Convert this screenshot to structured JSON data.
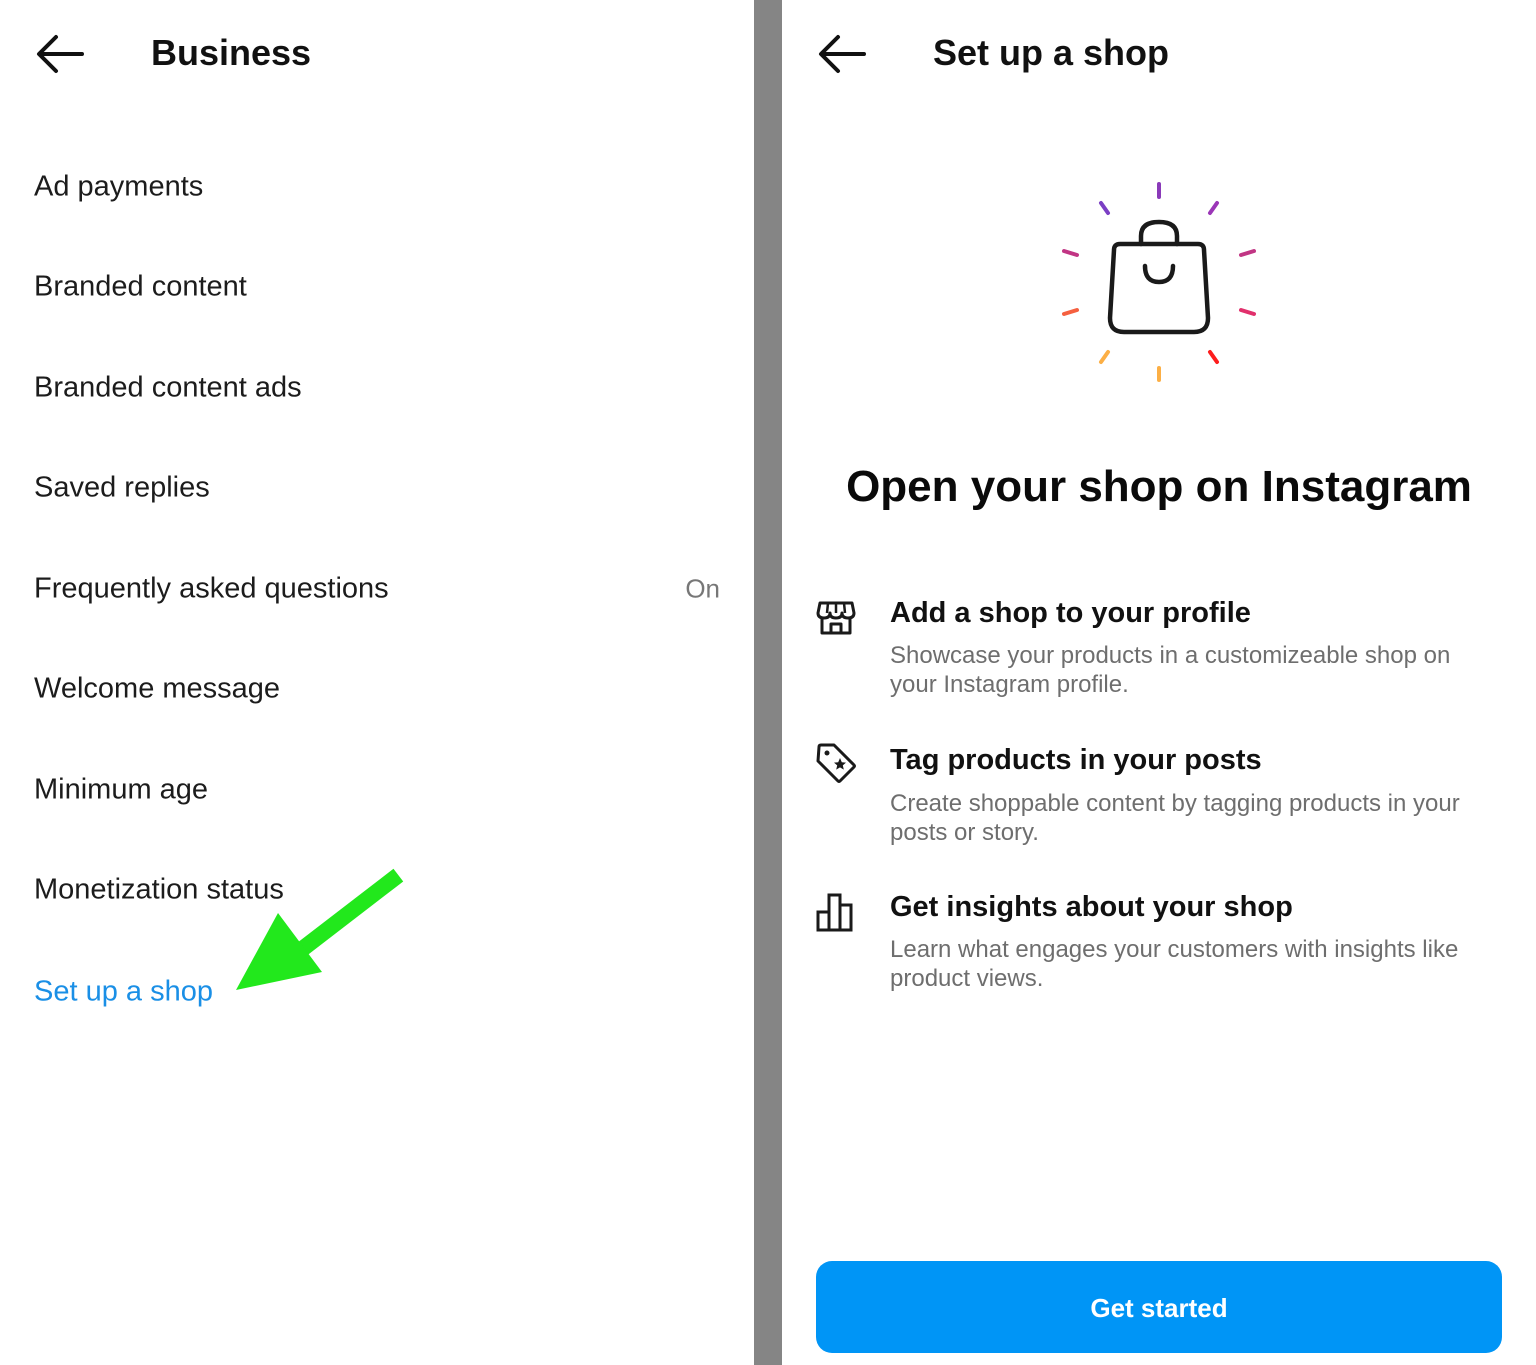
{
  "left_screen": {
    "header": {
      "title": "Business"
    },
    "menu": [
      {
        "label": "Ad payments"
      },
      {
        "label": "Branded content"
      },
      {
        "label": "Branded content ads"
      },
      {
        "label": "Saved replies"
      },
      {
        "label": "Frequently asked questions",
        "value": "On"
      },
      {
        "label": "Welcome message"
      },
      {
        "label": "Minimum age"
      },
      {
        "label": "Monetization status"
      }
    ],
    "link_item": {
      "label": "Set up a shop"
    }
  },
  "right_screen": {
    "header": {
      "title": "Set up a shop"
    },
    "hero_title": "Open your shop on Instagram",
    "features": [
      {
        "icon": "storefront-icon",
        "title": "Add a shop to your profile",
        "description": "Showcase your products in a customizeable shop on your Instagram profile."
      },
      {
        "icon": "tag-star-icon",
        "title": "Tag products in your posts",
        "description": "Create shoppable content by tagging products in your posts or story."
      },
      {
        "icon": "bar-chart-icon",
        "title": "Get insights about your shop",
        "description": "Learn what engages your customers with insights like product views."
      }
    ],
    "cta_label": "Get started"
  },
  "colors": {
    "link": "#1a8fe6",
    "cta": "#0095f6",
    "annotation_arrow": "#22e81c",
    "divider": "#858585"
  }
}
